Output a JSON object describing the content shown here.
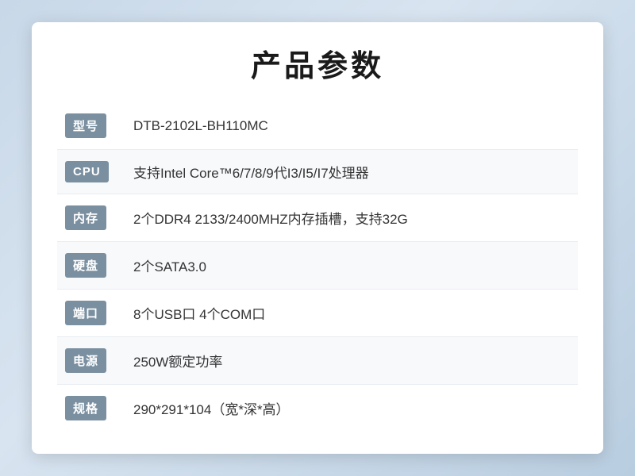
{
  "page": {
    "title": "产品参数",
    "rows": [
      {
        "label": "型号",
        "value": "DTB-2102L-BH110MC"
      },
      {
        "label": "CPU",
        "value": "支持Intel Core™6/7/8/9代I3/I5/I7处理器"
      },
      {
        "label": "内存",
        "value": "2个DDR4 2133/2400MHZ内存插槽，支持32G"
      },
      {
        "label": "硬盘",
        "value": "2个SATA3.0"
      },
      {
        "label": "端口",
        "value": "8个USB口 4个COM口"
      },
      {
        "label": "电源",
        "value": "250W额定功率"
      },
      {
        "label": "规格",
        "value": "290*291*104（宽*深*高）"
      }
    ]
  }
}
